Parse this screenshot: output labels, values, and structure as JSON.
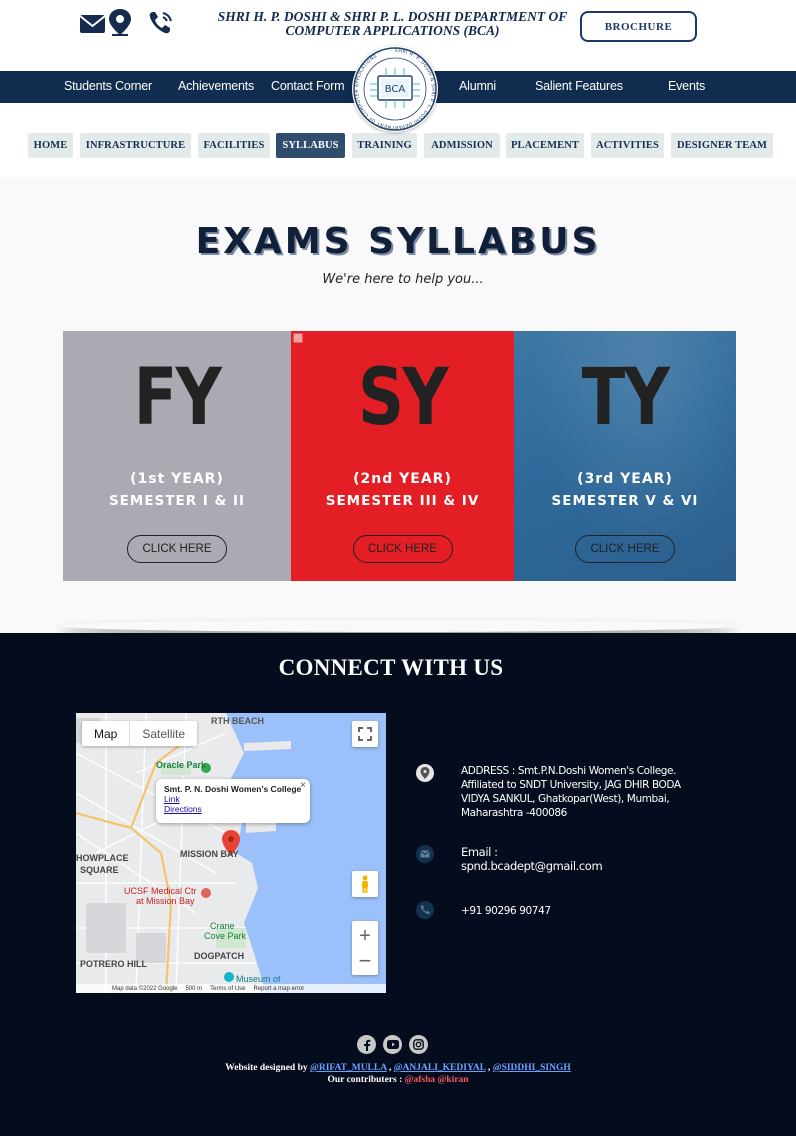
{
  "header": {
    "title_line1": "SHRI H. P. DOSHI & SHRI P. L. DOSHI  DEPARTMENT OF",
    "title_line2": "COMPUTER APPLICATIONS (BCA)",
    "brochure_label": "BROCHURE",
    "icons": [
      "mail-location-icon",
      "phone-icon"
    ]
  },
  "nav": {
    "items": [
      "Students Corner",
      "Achievements",
      "Contact Form",
      "Alumni",
      "Salient Features",
      "Events"
    ],
    "logo_text": "BCA"
  },
  "tabs": {
    "items": [
      "HOME",
      "INFRASTRUCTURE",
      "FACILITIES",
      "SYLLABUS",
      "TRAINING",
      "ADMISSION",
      "PLACEMENT",
      "ACTIVITIES",
      "DESIGNER TEAM"
    ],
    "active": "SYLLABUS"
  },
  "main": {
    "title": "EXAMS SYLLABUS",
    "subtitle": "We're here to help you...",
    "cards": [
      {
        "code": "FY",
        "year": "(1st YEAR)",
        "semester": "SEMESTER I & II",
        "cta": "CLICK HERE",
        "color": "#a9aab2"
      },
      {
        "code": "SY",
        "year": "(2nd YEAR)",
        "semester": "SEMESTER III & IV",
        "cta": "CLICK HERE",
        "color": "#e31f25"
      },
      {
        "code": "TY",
        "year": "(3rd YEAR)",
        "semester": "SEMESTER V & VI",
        "cta": "CLICK HERE",
        "color": "#2e6a9b"
      }
    ]
  },
  "footer": {
    "title": "CONNECT WITH US",
    "map": {
      "tab_map": "Map",
      "tab_satellite": "Satellite",
      "place_name": "Smt. P. N. Doshi Women's College",
      "link1": "Link",
      "link2": "Directions",
      "labels": {
        "north_beach": "RTH BEACH",
        "oracle_park": "Oracle Park",
        "mission_bay": "MISSION BAY",
        "south_market": "HOWPLACE",
        "square": "SQUARE",
        "ucsf1": "UCSF Medical Ctr",
        "ucsf2": "at Mission Bay",
        "crane1": "Crane",
        "crane2": "Cove Park",
        "potrero": "POTRERO HILL",
        "dogpatch": "DOGPATCH",
        "museum": "Museum of"
      },
      "footer_data": "Map data ©2022 Google",
      "footer_scale": "500 m",
      "footer_terms": "Terms of Use",
      "footer_report": "Report a map error"
    },
    "contact": {
      "address": "ADDRESS : Smt.P.N.Doshi Women's College. Affiliated to SNDT University, JAG DHIR BODA VIDYA SANKUL, Ghatkopar(West), Mumbai, Maharashtra -400086",
      "email_label": "Email :",
      "email": "spnd.bcadept@gmail.com",
      "phone": "+91 90296 90747"
    },
    "social_icons": [
      "facebook-icon",
      "youtube-icon",
      "instagram-icon"
    ],
    "credits": {
      "designed_by": "Website designed by",
      "designer1": "@RIFAT_MULLA",
      "designer2": "@ANJALI_KEDIYAL",
      "designer3": "@SIDDHI_SINGH",
      "contributors_label": "Our contributers :",
      "contributor1": "@afsha",
      "contributor2": "@kiran"
    }
  }
}
